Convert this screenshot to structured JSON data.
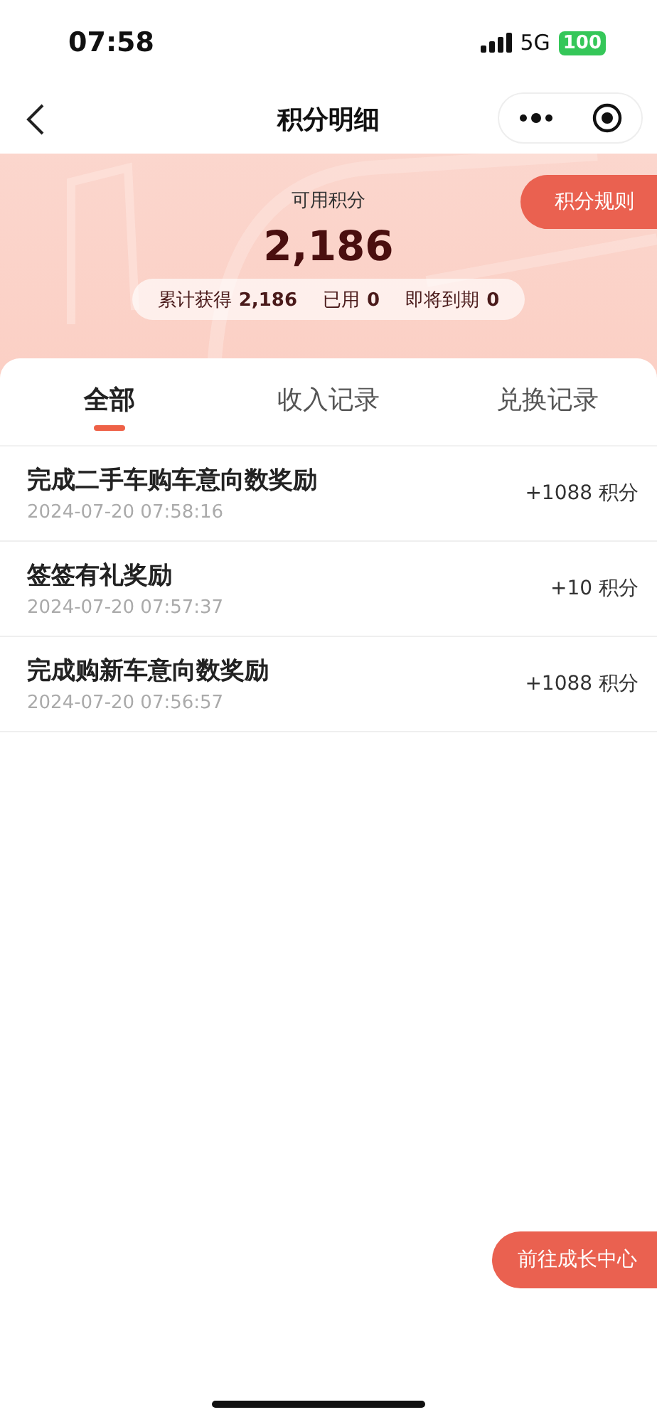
{
  "status_bar": {
    "time": "07:58",
    "network": "5G",
    "battery": "100"
  },
  "nav": {
    "title": "积分明细"
  },
  "header": {
    "rules_button": "积分规则",
    "label": "可用积分",
    "points": "2,186",
    "stats": [
      {
        "label": "累计获得",
        "value": "2,186"
      },
      {
        "label": "已用",
        "value": "0"
      },
      {
        "label": "即将到期",
        "value": "0"
      }
    ]
  },
  "tabs": [
    {
      "label": "全部",
      "selected": true
    },
    {
      "label": "收入记录",
      "selected": false
    },
    {
      "label": "兑换记录",
      "selected": false
    }
  ],
  "records": [
    {
      "title": "完成二手车购车意向数奖励",
      "time": "2024-07-20 07:58:16",
      "points": "+1088 积分"
    },
    {
      "title": "签签有礼奖励",
      "time": "2024-07-20 07:57:37",
      "points": "+10 积分"
    },
    {
      "title": "完成购新车意向数奖励",
      "time": "2024-07-20 07:56:57",
      "points": "+1088 积分"
    }
  ],
  "float_button": "前往成长中心"
}
